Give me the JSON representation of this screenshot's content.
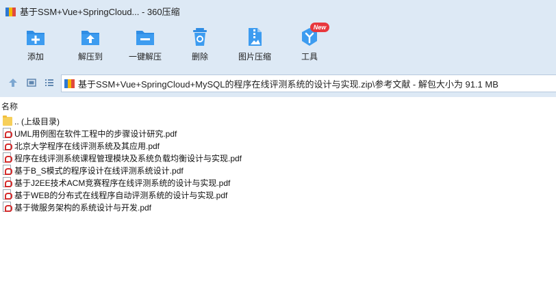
{
  "window": {
    "title": "基于SSM+Vue+SpringCloud... - 360压缩"
  },
  "toolbar": {
    "items": [
      {
        "label": "添加",
        "icon": "add-folder-icon"
      },
      {
        "label": "解压到",
        "icon": "extract-to-icon"
      },
      {
        "label": "一键解压",
        "icon": "one-click-extract-icon"
      },
      {
        "label": "删除",
        "icon": "delete-trash-icon"
      },
      {
        "label": "图片压缩",
        "icon": "image-compress-icon"
      },
      {
        "label": "工具",
        "icon": "tools-icon",
        "badge": "New"
      }
    ]
  },
  "addressbar": {
    "path": "基于SSM+Vue+SpringCloud+MySQL的程序在线评测系统的设计与实现.zip\\参考文献 - 解包大小为 91.1 MB"
  },
  "list": {
    "header": "名称",
    "rows": [
      {
        "name": ".. (上级目录)",
        "type": "folder"
      },
      {
        "name": "UML用例图在软件工程中的步骤设计研究.pdf",
        "type": "pdf"
      },
      {
        "name": "北京大学程序在线评测系统及其应用.pdf",
        "type": "pdf"
      },
      {
        "name": "程序在线评测系统课程管理模块及系统负载均衡设计与实现.pdf",
        "type": "pdf"
      },
      {
        "name": "基于B_S模式的程序设计在线评测系统设计.pdf",
        "type": "pdf"
      },
      {
        "name": "基于J2EE技术ACM竞赛程序在线评测系统的设计与实现.pdf",
        "type": "pdf"
      },
      {
        "name": "基于WEB的分布式在线程序自动评测系统的设计与实现.pdf",
        "type": "pdf"
      },
      {
        "name": "基于微服务架构的系统设计与开发.pdf",
        "type": "pdf"
      }
    ]
  },
  "colors": {
    "chrome_bg": "#dde9f5",
    "icon_blue": "#2f8de4",
    "badge_red": "#e8383d"
  }
}
